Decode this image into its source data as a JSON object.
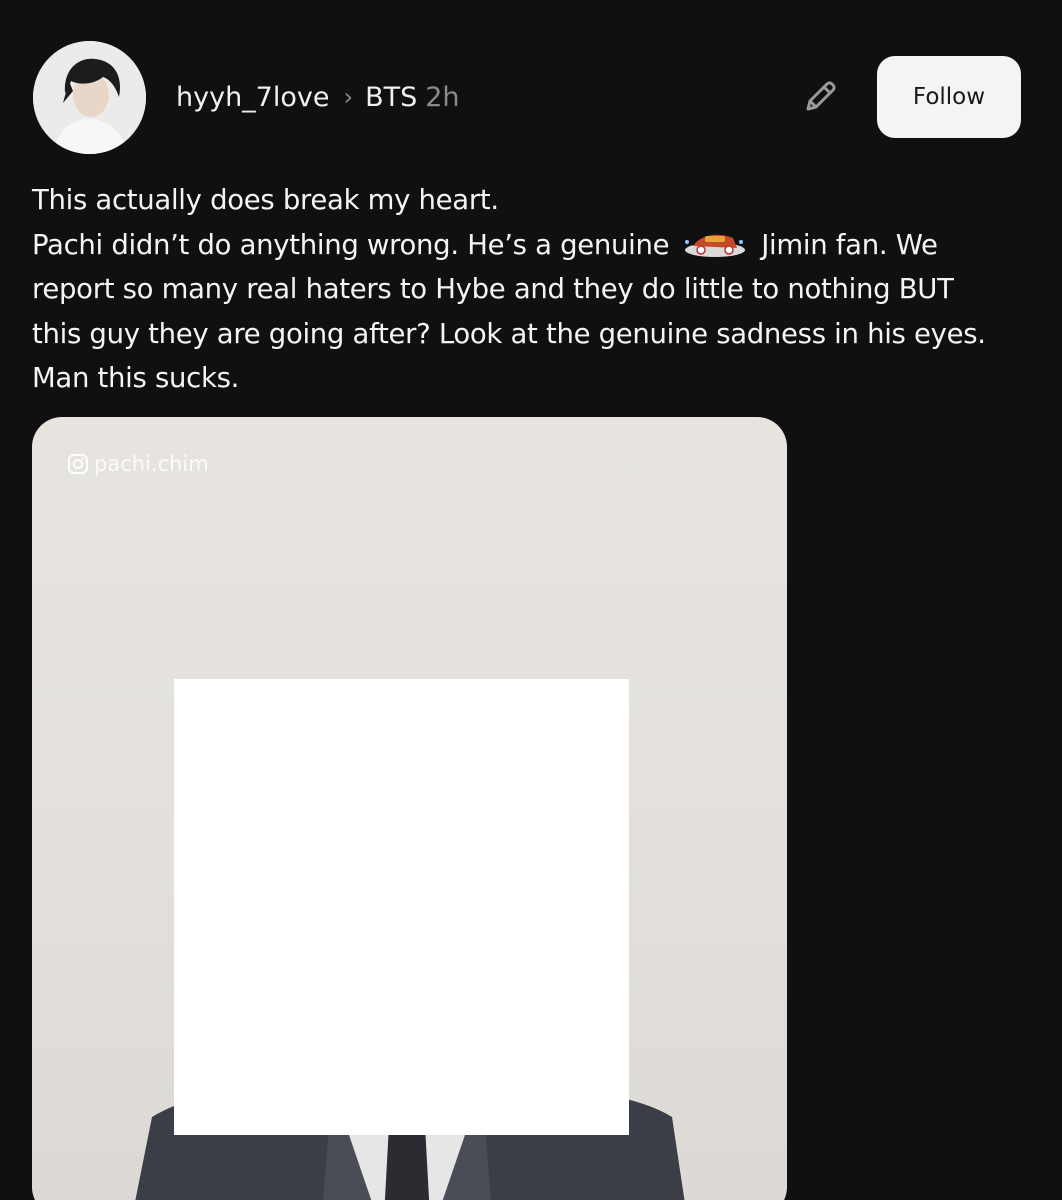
{
  "post": {
    "username": "hyyh_7love",
    "community": "BTS",
    "time": "2h",
    "follow_label": "Follow",
    "text_lines": [
      "This actually does break my heart.",
      "Pachi didn’t do anything wrong. He’s a genuine",
      "Jimin fan. We",
      "report so many real haters to Hybe and they do little to nothing BUT",
      "this guy they are going after? Look at the genuine sadness in his eyes.",
      "Man this sucks."
    ],
    "emoji_icon": "flower-sticker-icon",
    "media": {
      "watermark": "pachi.chim",
      "watermark_icon": "instagram-icon"
    }
  },
  "icons": {
    "edit": "pencil-icon",
    "separator": "chevron-right-icon"
  },
  "colors": {
    "background": "#101012",
    "text": "#f2f2f2",
    "muted": "#8b8b8e",
    "follow_bg": "#f4f4f5",
    "follow_text": "#1a1a1c"
  }
}
